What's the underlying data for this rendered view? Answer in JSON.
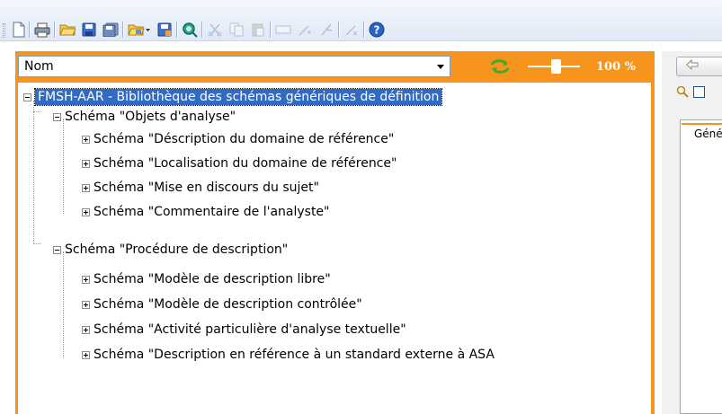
{
  "toolbar": {
    "buttons": [
      {
        "icon": "new-document-icon",
        "enabled": true
      },
      {
        "icon": "print-icon",
        "enabled": true
      },
      {
        "icon": "open-folder-icon",
        "enabled": true
      },
      {
        "icon": "save-icon",
        "enabled": true
      },
      {
        "icon": "save-all-icon",
        "enabled": true
      },
      {
        "icon": "open-folder-dropdown-icon",
        "enabled": true
      },
      {
        "icon": "save-as-icon",
        "enabled": true
      },
      {
        "icon": "preview-icon",
        "enabled": true
      },
      {
        "icon": "cut-icon",
        "enabled": false
      },
      {
        "icon": "copy-icon",
        "enabled": false
      },
      {
        "icon": "paste-icon",
        "enabled": false
      },
      {
        "icon": "field-icon",
        "enabled": false
      },
      {
        "icon": "add-link-icon",
        "enabled": false
      },
      {
        "icon": "branch-icon",
        "enabled": false
      },
      {
        "icon": "remove-link-icon",
        "enabled": false
      },
      {
        "icon": "help-icon",
        "enabled": true
      }
    ]
  },
  "left": {
    "combo_value": "Nom",
    "zoom_label": "100 %",
    "zoom_fraction": 0.55
  },
  "tree": {
    "root": "FMSH-AAR - Bibliothèque des schémas génériques de définition",
    "groups": [
      {
        "label": "Schéma \"Objets d'analyse\"",
        "children": [
          "Schéma \"Déscription du domaine de référence\"",
          "Schéma \"Localisation du domaine de référence\"",
          "Schéma \"Mise en discours du sujet\"",
          "Schéma \"Commentaire de l'analyste\""
        ]
      },
      {
        "label": "Schéma \"Procédure de description\"",
        "children": [
          "Schéma \"Modèle de description libre\"",
          "Schéma \"Modèle de description contrôlée\"",
          "Schéma \"Activité particulière d'analyse textuelle\"",
          "Schéma \"Description en référence à un standard externe à ASA"
        ]
      }
    ]
  },
  "right": {
    "tab_label": "Géné"
  },
  "colors": {
    "accent_orange": "#f7941d",
    "selection_blue": "#316ac5",
    "toolbar_bg": "#dfe9f6"
  }
}
